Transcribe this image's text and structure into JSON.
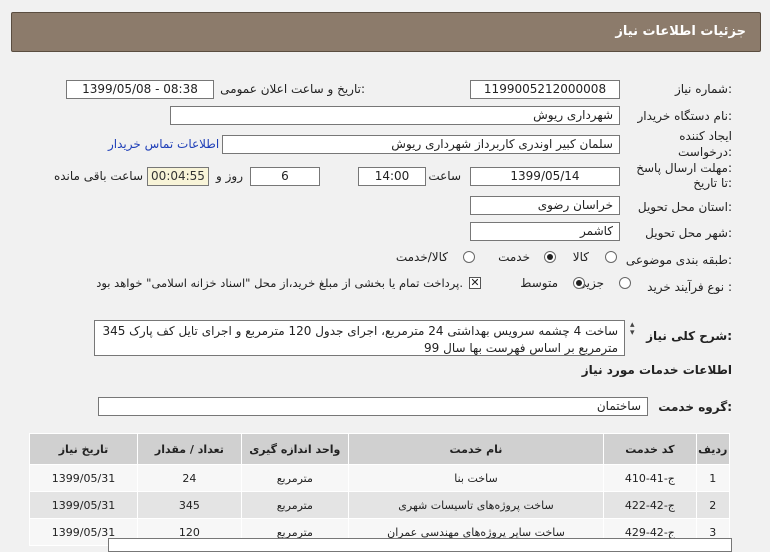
{
  "page": {
    "title": "جزئیات اطلاعات نیاز"
  },
  "form": {
    "need_number_label": "شماره نیاز:",
    "need_number": "1199005212000008",
    "announce_label": "تاریخ و ساعت اعلان عمومی:",
    "announce_value": "1399/05/08 - 08:38",
    "buyer_org_label": "نام دستگاه خریدار:",
    "buyer_org": "شهرداری ریوش",
    "creator_label_1": "ایجاد کننده",
    "creator_label_2": "درخواست:",
    "creator": "سلمان کبیر اوندری کاربرداز شهرداری ریوش",
    "contact_link": "اطلاعات تماس خریدار",
    "deadline_label_1": "مهلت ارسال پاسخ:",
    "deadline_label_2": "تا تاریخ:",
    "deadline_date": "1399/05/14",
    "time_label": "ساعت",
    "deadline_time": "14:00",
    "days_value": "6",
    "days_label": "روز و",
    "remaining_time": "00:04:55",
    "remaining_label": "ساعت باقی مانده",
    "province_label": "استان محل تحویل:",
    "province": "خراسان رضوی",
    "city_label": "شهر محل تحویل:",
    "city": "کاشمر",
    "category_label": "طبقه بندی موضوعی:",
    "category_options": [
      "کالا",
      "خدمت",
      "کالا/خدمت"
    ],
    "category_selected": "خدمت",
    "process_label": "نوع فرآیند خرید :",
    "process_options": [
      "جزیی",
      "متوسط"
    ],
    "process_selected": "متوسط",
    "payment_note": "پرداخت تمام یا بخشی از مبلغ خرید،از محل \"اسناد خزانه اسلامی\" خواهد بود.",
    "payment_checked": true,
    "description_label": "شرح کلی نیاز:",
    "description": "ساخت 4 چشمه سرویس بهداشتی  24 مترمربع، اجرای جدول 120 مترمربع و اجرای تایل کف پارک 345 مترمربع بر اساس فهرست بها سال 99"
  },
  "services": {
    "section_title": "اطلاعات خدمات مورد نیاز",
    "group_label": "گروه خدمت:",
    "group_value": "ساختمان",
    "columns": [
      "ردیف",
      "کد خدمت",
      "نام خدمت",
      "واحد اندازه گیری",
      "تعداد / مقدار",
      "تاریخ نیاز"
    ],
    "rows": [
      [
        "1",
        "ج-41-410",
        "ساخت بنا",
        "مترمربع",
        "24",
        "1399/05/31"
      ],
      [
        "2",
        "ج-42-422",
        "ساخت پروژه‌های تاسیسات شهری",
        "مترمربع",
        "345",
        "1399/05/31"
      ],
      [
        "3",
        "ج-42-429",
        "ساخت سایر پروژه‌های مهندسی عمران",
        "مترمربع",
        "120",
        "1399/05/31"
      ]
    ]
  }
}
